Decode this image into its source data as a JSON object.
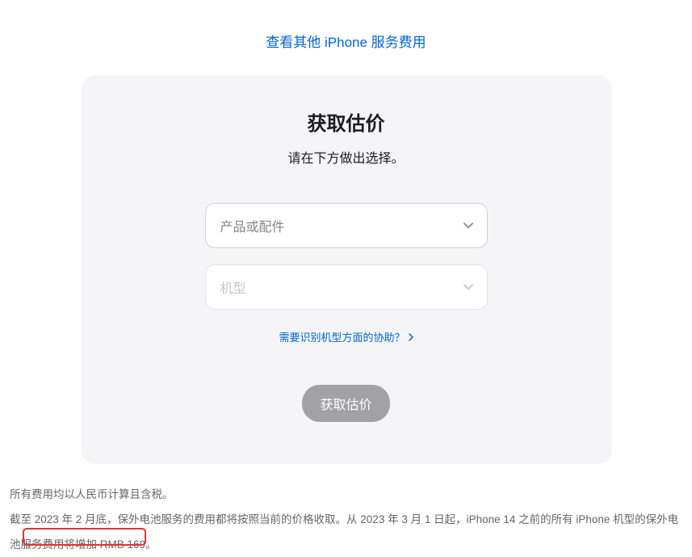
{
  "topLink": {
    "label": "查看其他 iPhone 服务费用"
  },
  "card": {
    "title": "获取估价",
    "subtitle": "请在下方做出选择。",
    "productPlaceholder": "产品或配件",
    "modelPlaceholder": "机型",
    "helpLink": "需要识别机型方面的协助？",
    "buttonLabel": "获取估价"
  },
  "footer": {
    "line1": "所有费用均以人民币计算且含税。",
    "line2": "截至 2023 年 2 月底，保外电池服务的费用都将按照当前的价格收取。从 2023 年 3 月 1 日起，iPhone 14 之前的所有 iPhone 机型的保外电池服务费用将增加 RMB 169。"
  }
}
